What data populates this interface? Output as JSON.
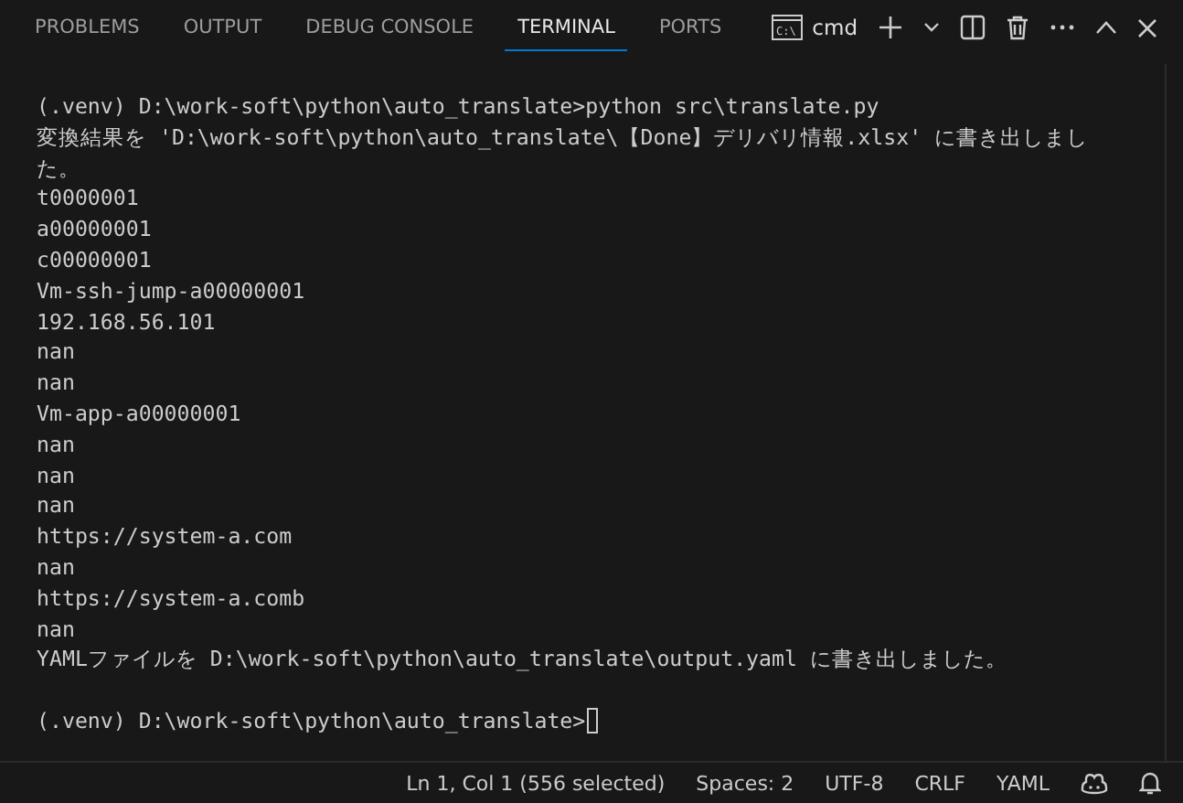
{
  "tabs": [
    {
      "label": "PROBLEMS",
      "selected": false
    },
    {
      "label": "OUTPUT",
      "selected": false
    },
    {
      "label": "DEBUG CONSOLE",
      "selected": false
    },
    {
      "label": "TERMINAL",
      "selected": true
    },
    {
      "label": "PORTS",
      "selected": false
    }
  ],
  "terminal_switcher": {
    "icon_text": "C:\\",
    "label": "cmd"
  },
  "terminal": {
    "lines": [
      "(.venv) D:\\work-soft\\python\\auto_translate>python src\\translate.py",
      "変換結果を 'D:\\work-soft\\python\\auto_translate\\【Done】デリバリ情報.xlsx' に書き出しました。",
      "t0000001",
      "a00000001",
      "c00000001",
      "Vm-ssh-jump-a00000001",
      "192.168.56.101",
      "nan",
      "nan",
      "Vm-app-a00000001",
      "nan",
      "nan",
      "nan",
      "https://system-a.com",
      "nan",
      "https://system-a.comb",
      "nan",
      "YAMLファイルを D:\\work-soft\\python\\auto_translate\\output.yaml に書き出しました。"
    ],
    "prompt": "(.venv) D:\\work-soft\\python\\auto_translate>"
  },
  "status_bar": {
    "items": [
      "Ln 1, Col 1 (556 selected)",
      "Spaces: 2",
      "UTF-8",
      "CRLF",
      "YAML"
    ]
  }
}
